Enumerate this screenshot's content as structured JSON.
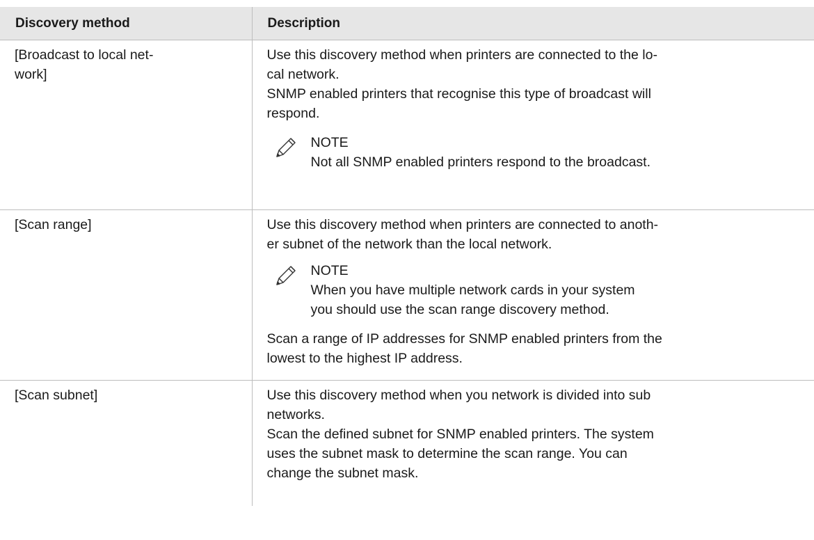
{
  "table": {
    "headers": {
      "method": "Discovery method",
      "description": "Description"
    },
    "rows": [
      {
        "method": "[Broadcast to local net-\nwork]",
        "desc_line1": "Use this discovery method when printers are connected to the lo-",
        "desc_line2": "cal network.",
        "desc_line3": "SNMP enabled printers that recognise this type of broadcast will",
        "desc_line4": "respond.",
        "note_title": "NOTE",
        "note_line1": "Not all SNMP enabled printers respond to the broadcast."
      },
      {
        "method": "[Scan range]",
        "desc_line1": "Use this discovery method when printers are connected to anoth-",
        "desc_line2": "er subnet of the network than the local network.",
        "note_title": "NOTE",
        "note_line1": "When you have multiple network cards in your system",
        "note_line2": "you should use the scan range discovery method.",
        "after_line1": "Scan a range of IP addresses for SNMP enabled printers from the",
        "after_line2": "lowest to the highest IP address."
      },
      {
        "method": "[Scan subnet]",
        "desc_line1": "Use this discovery method when you network is divided into sub",
        "desc_line2": "networks.",
        "desc_line3": "Scan the defined subnet for SNMP enabled printers. The system",
        "desc_line4": "uses the subnet mask to determine the scan range. You can",
        "desc_line5": "change the subnet mask."
      }
    ]
  }
}
